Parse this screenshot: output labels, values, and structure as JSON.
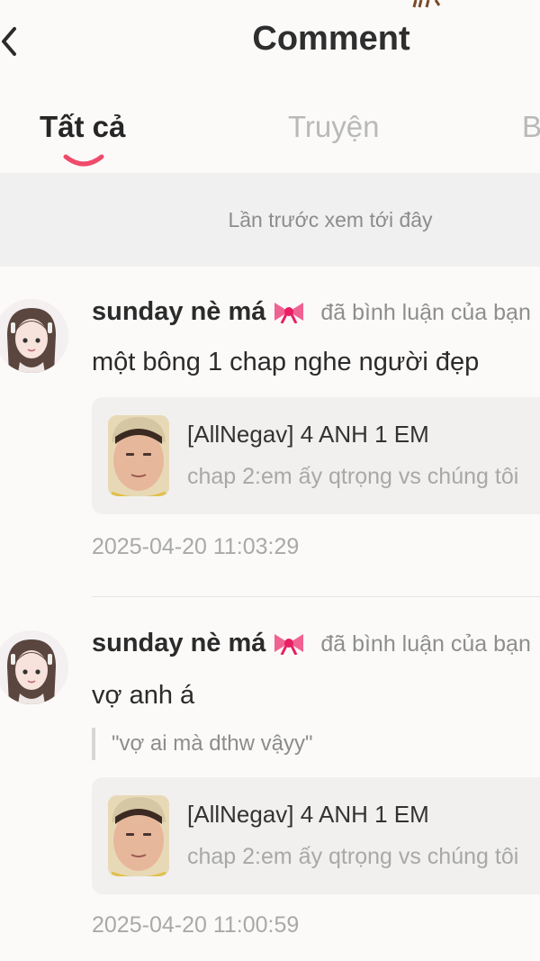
{
  "header": {
    "title": "Comment",
    "back_icon": "chevron-left-icon"
  },
  "tabs": [
    {
      "label": "Tất cả",
      "active": true
    },
    {
      "label": "Truyện",
      "active": false
    },
    {
      "label": "B",
      "active": false
    }
  ],
  "notice": "Lần trước xem tới đây",
  "accent_color": "#f04a6a",
  "comments": [
    {
      "username": "sunday nè má",
      "user_icon": "bow-icon",
      "action": "đã bình luận của bạn",
      "content": "một bông 1 chap nghe người đẹp",
      "quote": "",
      "card": {
        "title": "[AllNegav] 4 ANH 1 EM",
        "subtitle": "chap 2:em ấy qtrọng vs chúng tôi"
      },
      "time": "2025-04-20 11:03:29"
    },
    {
      "username": "sunday nè má",
      "user_icon": "bow-icon",
      "action": "đã bình luận của bạn",
      "content": "vợ anh á",
      "quote": "\"vợ ai mà dthw vậyy\"",
      "card": {
        "title": "[AllNegav] 4 ANH 1 EM",
        "subtitle": "chap 2:em ấy qtrọng vs chúng tôi"
      },
      "time": "2025-04-20 11:00:59"
    }
  ]
}
